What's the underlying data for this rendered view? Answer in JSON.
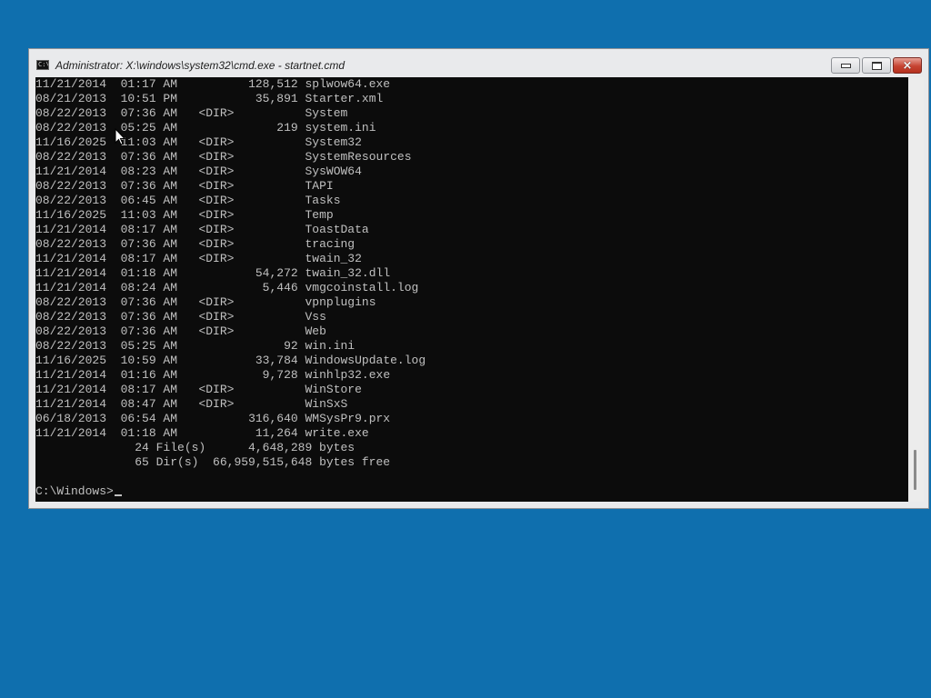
{
  "window": {
    "title": "Administrator: X:\\windows\\system32\\cmd.exe - startnet.cmd",
    "icon": "cmd-app-icon",
    "icon_label": "C:\\",
    "buttons": {
      "minimize": "minimize-icon",
      "maximize": "maximize-icon",
      "close": "×"
    }
  },
  "console": {
    "entries": [
      {
        "date": "11/21/2014",
        "time": "01:17 AM",
        "dir": "",
        "size": "128,512",
        "name": "splwow64.exe"
      },
      {
        "date": "08/21/2013",
        "time": "10:51 PM",
        "dir": "",
        "size": "35,891",
        "name": "Starter.xml"
      },
      {
        "date": "08/22/2013",
        "time": "07:36 AM",
        "dir": "<DIR>",
        "size": "",
        "name": "System"
      },
      {
        "date": "08/22/2013",
        "time": "05:25 AM",
        "dir": "",
        "size": "219",
        "name": "system.ini"
      },
      {
        "date": "11/16/2025",
        "time": "11:03 AM",
        "dir": "<DIR>",
        "size": "",
        "name": "System32"
      },
      {
        "date": "08/22/2013",
        "time": "07:36 AM",
        "dir": "<DIR>",
        "size": "",
        "name": "SystemResources"
      },
      {
        "date": "11/21/2014",
        "time": "08:23 AM",
        "dir": "<DIR>",
        "size": "",
        "name": "SysWOW64"
      },
      {
        "date": "08/22/2013",
        "time": "07:36 AM",
        "dir": "<DIR>",
        "size": "",
        "name": "TAPI"
      },
      {
        "date": "08/22/2013",
        "time": "06:45 AM",
        "dir": "<DIR>",
        "size": "",
        "name": "Tasks"
      },
      {
        "date": "11/16/2025",
        "time": "11:03 AM",
        "dir": "<DIR>",
        "size": "",
        "name": "Temp"
      },
      {
        "date": "11/21/2014",
        "time": "08:17 AM",
        "dir": "<DIR>",
        "size": "",
        "name": "ToastData"
      },
      {
        "date": "08/22/2013",
        "time": "07:36 AM",
        "dir": "<DIR>",
        "size": "",
        "name": "tracing"
      },
      {
        "date": "11/21/2014",
        "time": "08:17 AM",
        "dir": "<DIR>",
        "size": "",
        "name": "twain_32"
      },
      {
        "date": "11/21/2014",
        "time": "01:18 AM",
        "dir": "",
        "size": "54,272",
        "name": "twain_32.dll"
      },
      {
        "date": "11/21/2014",
        "time": "08:24 AM",
        "dir": "",
        "size": "5,446",
        "name": "vmgcoinstall.log"
      },
      {
        "date": "08/22/2013",
        "time": "07:36 AM",
        "dir": "<DIR>",
        "size": "",
        "name": "vpnplugins"
      },
      {
        "date": "08/22/2013",
        "time": "07:36 AM",
        "dir": "<DIR>",
        "size": "",
        "name": "Vss"
      },
      {
        "date": "08/22/2013",
        "time": "07:36 AM",
        "dir": "<DIR>",
        "size": "",
        "name": "Web"
      },
      {
        "date": "08/22/2013",
        "time": "05:25 AM",
        "dir": "",
        "size": "92",
        "name": "win.ini"
      },
      {
        "date": "11/16/2025",
        "time": "10:59 AM",
        "dir": "",
        "size": "33,784",
        "name": "WindowsUpdate.log"
      },
      {
        "date": "11/21/2014",
        "time": "01:16 AM",
        "dir": "",
        "size": "9,728",
        "name": "winhlp32.exe"
      },
      {
        "date": "11/21/2014",
        "time": "08:17 AM",
        "dir": "<DIR>",
        "size": "",
        "name": "WinStore"
      },
      {
        "date": "11/21/2014",
        "time": "08:47 AM",
        "dir": "<DIR>",
        "size": "",
        "name": "WinSxS"
      },
      {
        "date": "06/18/2013",
        "time": "06:54 AM",
        "dir": "",
        "size": "316,640",
        "name": "WMSysPr9.prx"
      },
      {
        "date": "11/21/2014",
        "time": "01:18 AM",
        "dir": "",
        "size": "11,264",
        "name": "write.exe"
      }
    ],
    "summary": {
      "files_count": "24 File(s)",
      "files_bytes": "4,648,289 bytes",
      "dirs_count": "65 Dir(s)",
      "dirs_bytes": "66,959,515,648 bytes free"
    },
    "prompt": "C:\\Windows>"
  },
  "colors": {
    "desktop": "#0f6fae",
    "console_bg": "#0c0c0c",
    "console_fg": "#c0c0c0",
    "close_button": "#c64432"
  }
}
